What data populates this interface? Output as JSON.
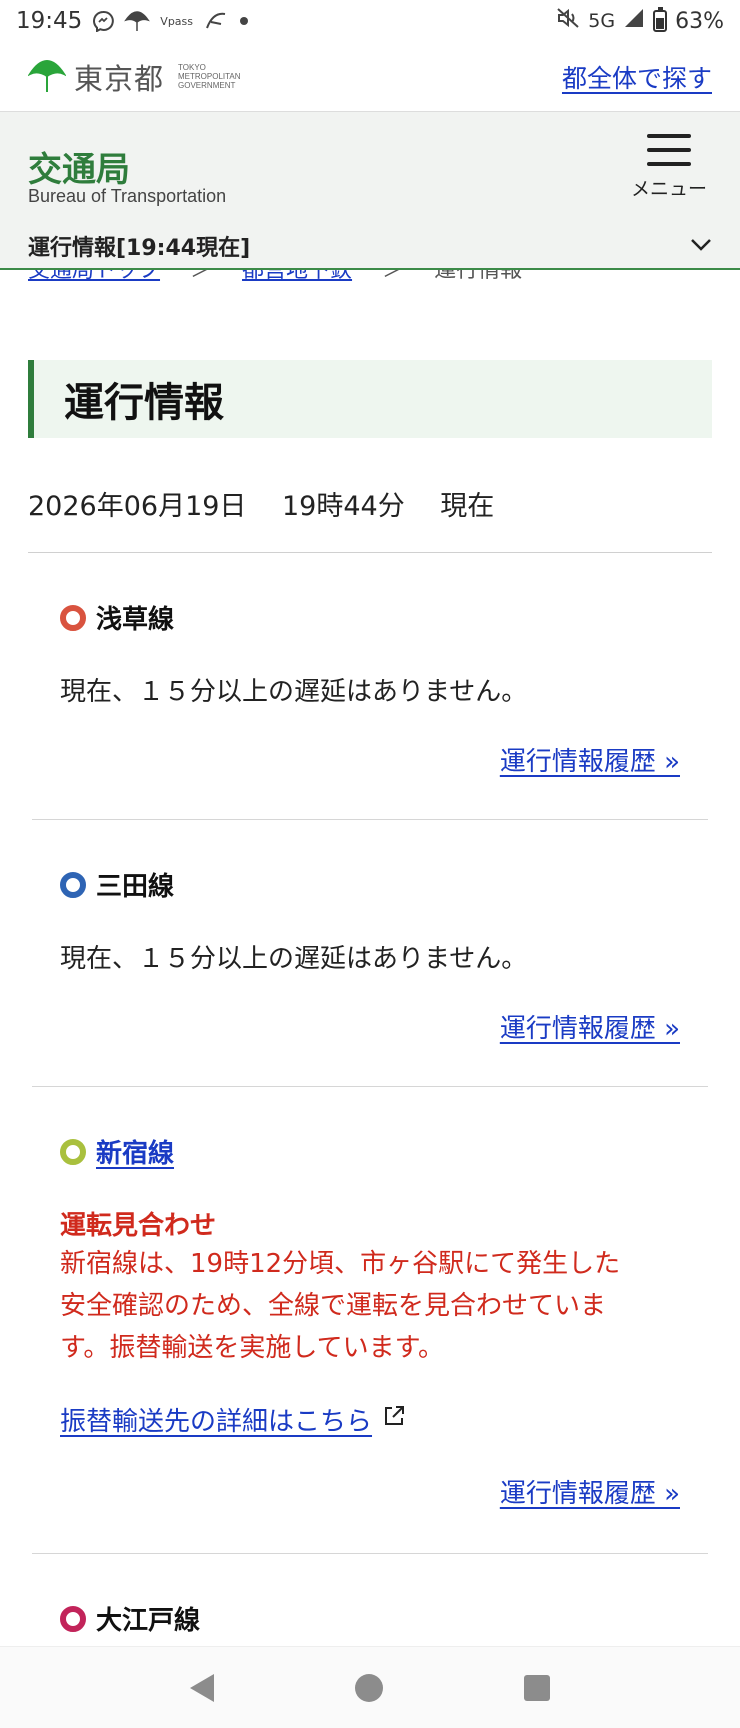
{
  "status_bar": {
    "time": "19:45",
    "vpass_label": "Vpass",
    "network": "5G",
    "battery": "63%",
    "battery_level": 0.63
  },
  "tokyo_header": {
    "logo_name": "東京都",
    "logo_sub_1": "TOKYO",
    "logo_sub_2": "METROPOLITAN",
    "logo_sub_3": "GOVERNMENT",
    "search_all": "都全体で探す",
    "logo_color": "#2aa53a"
  },
  "bureau_header": {
    "title": "交通局",
    "subtitle_en": "Bureau of Transportation",
    "menu_label": "メニュー",
    "status_label": "運行情報[19:44現在]"
  },
  "breadcrumb": {
    "items": [
      "交通局トップ",
      "都営地下鉄",
      "運行情報"
    ],
    "separator": "＞"
  },
  "page": {
    "heading": "運行情報",
    "datetime": "2026年06月19日　 19時44分　 現在"
  },
  "lines": [
    {
      "name": "浅草線",
      "color": "#d9533f",
      "message": "現在、１５分以上の遅延はありません。",
      "history": "運行情報履歴 »"
    },
    {
      "name": "三田線",
      "color": "#2e64b4",
      "message": "現在、１５分以上の遅延はありません。",
      "history": "運行情報履歴 »"
    },
    {
      "name": "新宿線",
      "color": "#a9c03e",
      "alert_title": "運転見合わせ",
      "alert_line1": "新宿線は、19時12分頃、市ヶ谷駅にて発生した",
      "alert_line2": "安全確認のため、全線で運転を見合わせていま",
      "alert_line3": "す。振替輸送を実施しています。",
      "detail_link": "振替輸送先の詳細はこちら",
      "history": "運行情報履歴 »"
    },
    {
      "name": "大江戸線",
      "color": "#c2245a"
    }
  ],
  "colors": {
    "accent_green": "#2f7d3c",
    "link_blue": "#1a3bc4",
    "alert_red": "#d02a1d"
  }
}
